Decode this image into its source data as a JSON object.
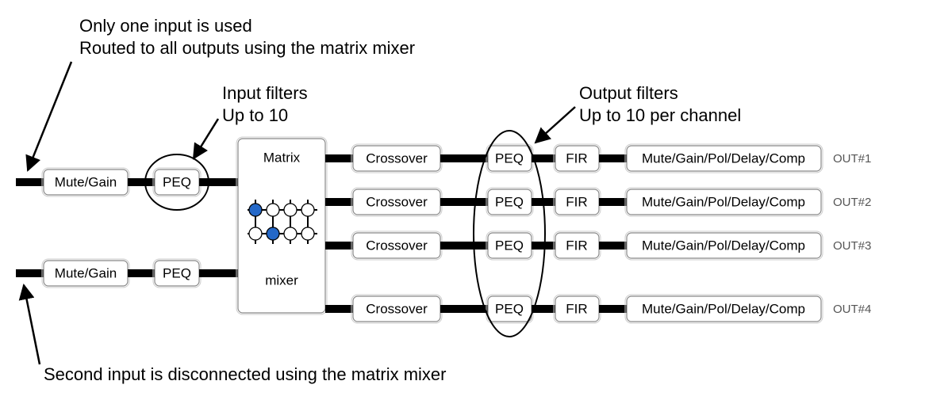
{
  "annotations": {
    "top_line1": "Only one input is used",
    "top_line2": "Routed to all outputs using the matrix mixer",
    "input_filters_line1": "Input filters",
    "input_filters_line2": "Up to 10",
    "output_filters_line1": "Output filters",
    "output_filters_line2": "Up to 10 per channel",
    "bottom_line1": "Second input is disconnected using the matrix mixer"
  },
  "blocks": {
    "mute_gain": "Mute/Gain",
    "peq": "PEQ",
    "matrix_top": "Matrix",
    "matrix_bottom": "mixer",
    "crossover": "Crossover",
    "fir": "FIR",
    "output_chain": "Mute/Gain/Pol/Delay/Comp"
  },
  "outputs": {
    "rows": [
      {
        "label": "OUT#1"
      },
      {
        "label": "OUT#2"
      },
      {
        "label": "OUT#3"
      },
      {
        "label": "OUT#4"
      }
    ]
  },
  "matrix_mixer": {
    "rows": 2,
    "cols": 4,
    "active_nodes": [
      [
        0,
        0
      ],
      [
        1,
        1
      ]
    ]
  }
}
